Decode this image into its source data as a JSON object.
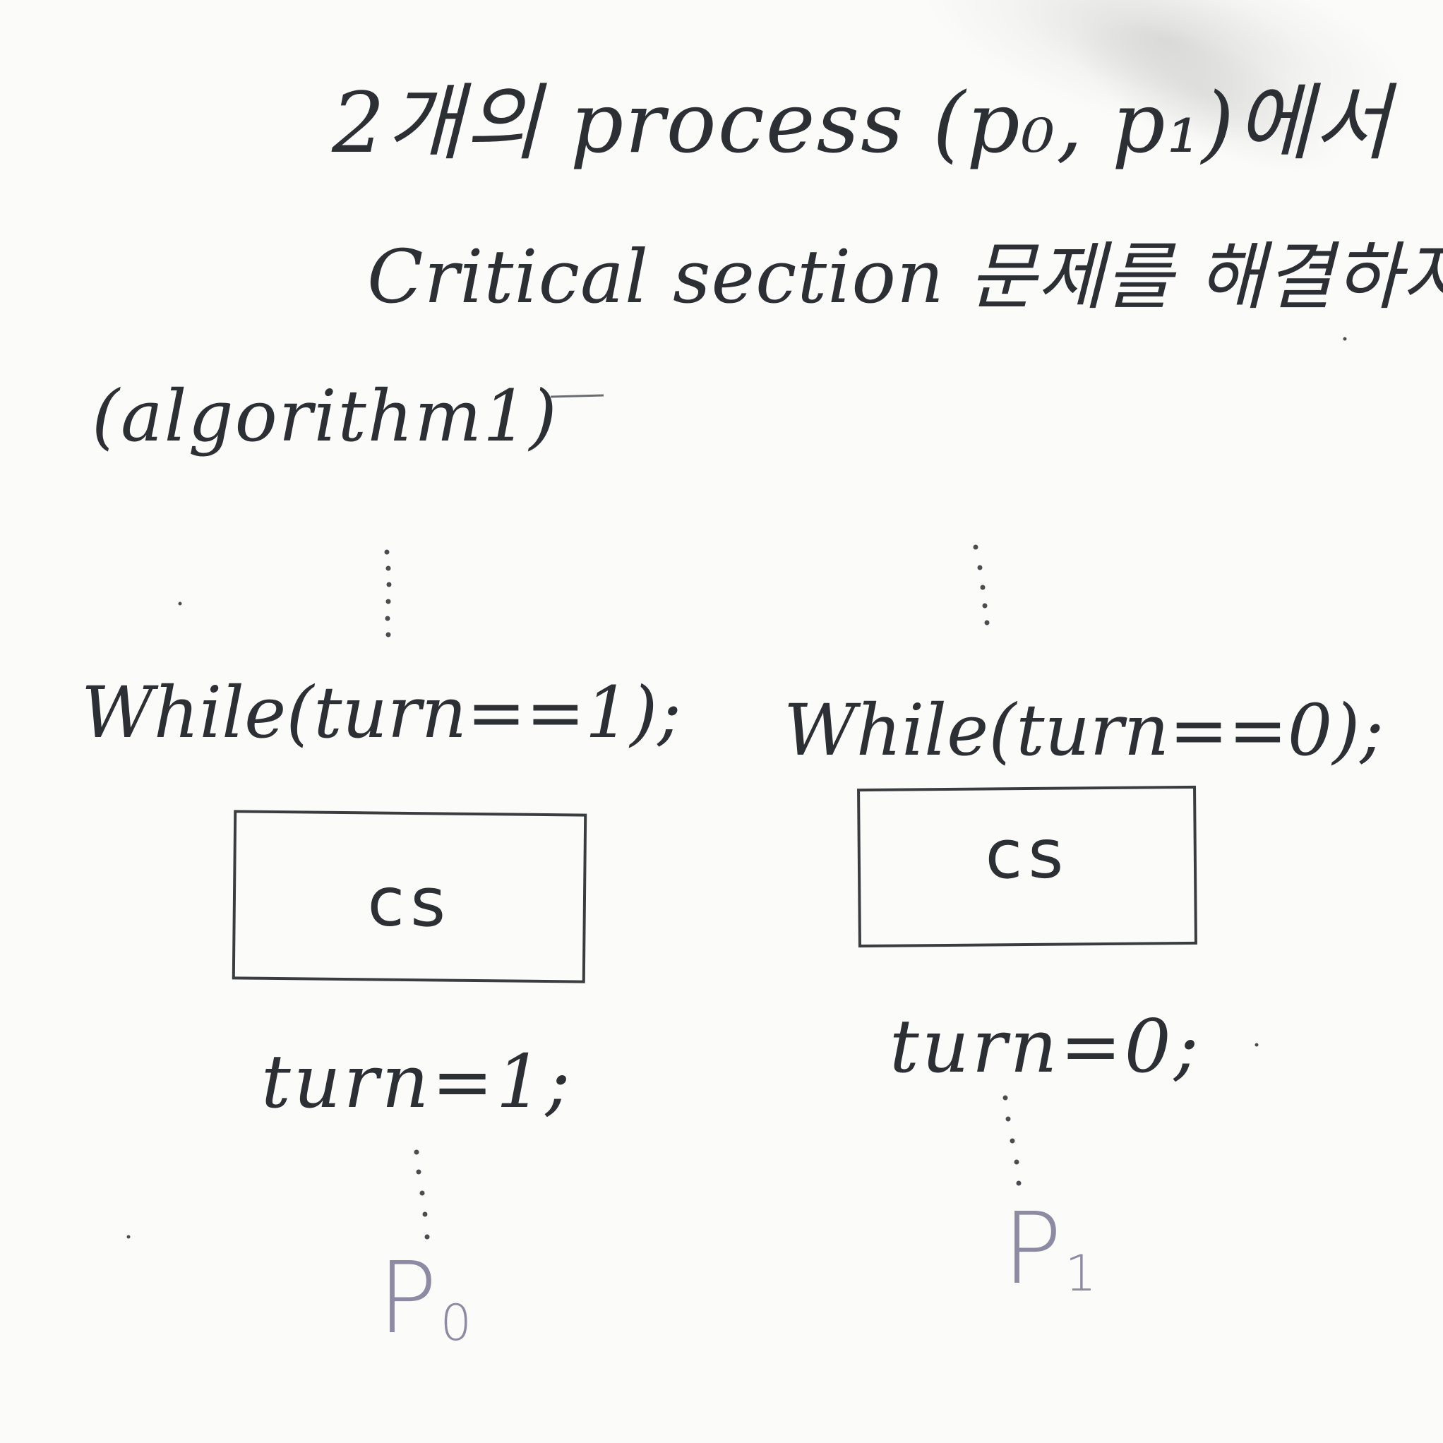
{
  "title_line_1": "2개의 process (p₀, p₁)에서",
  "title_line_2": "Critical section 문제를 해결하자.",
  "algorithm_label": "(algorithm1)",
  "p0": {
    "entry": "While(turn==1);",
    "critical_section": "cs",
    "exit": "turn=1;",
    "name": "P",
    "name_subscript": "0"
  },
  "p1": {
    "entry": "While(turn==0);",
    "critical_section": "cs",
    "exit": "turn=0;",
    "name": "P",
    "name_subscript": "1"
  },
  "colors": {
    "ink": "#2c2f33",
    "faded_ink": "#8d8aa3",
    "board": "#fbfbf9"
  }
}
